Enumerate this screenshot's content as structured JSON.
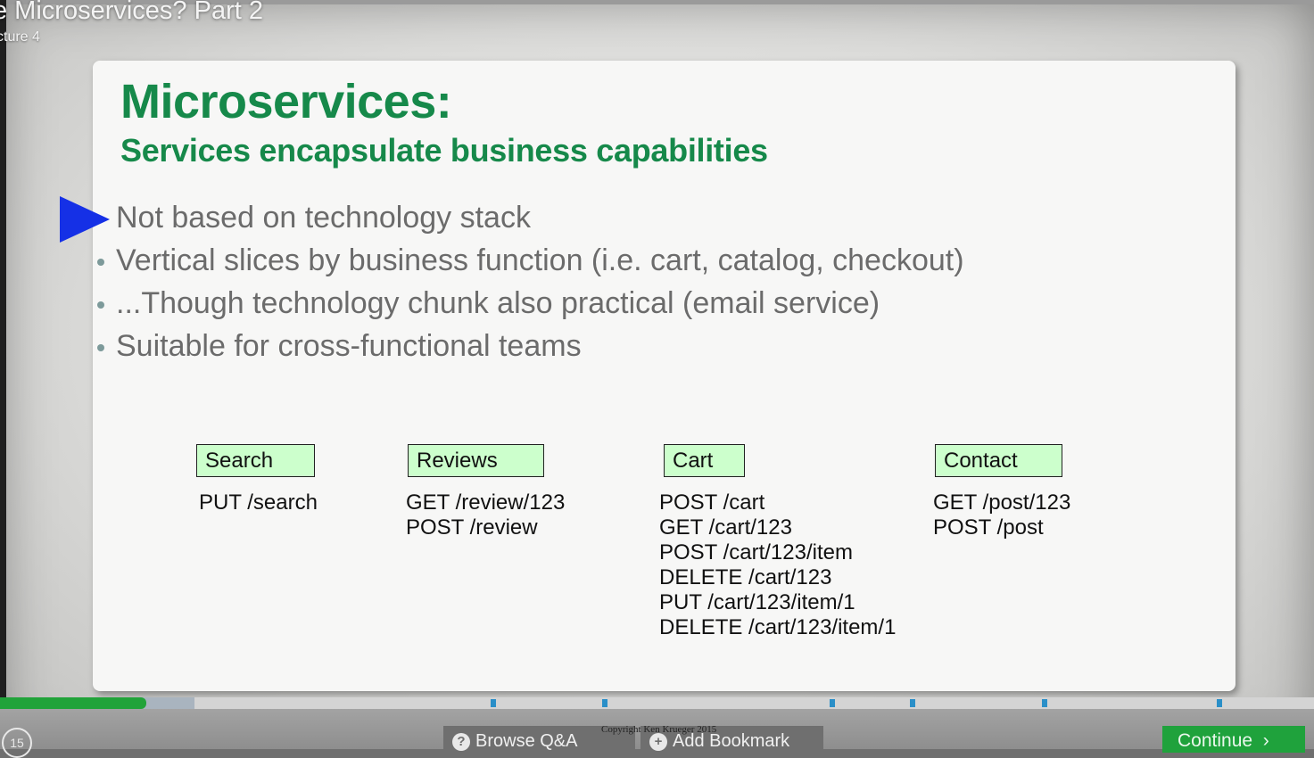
{
  "player": {
    "video_title": "e Microservices? Part 2",
    "video_subtitle": "cture 4"
  },
  "slide": {
    "title": "Microservices:",
    "subtitle": "Services encapsulate business capabilities",
    "bullets": [
      "Not based on technology stack",
      "Vertical slices by business function (i.e. cart, catalog, checkout)",
      "...Though technology chunk also practical (email service)",
      "Suitable for cross-functional teams"
    ],
    "services": [
      {
        "name": "Search",
        "endpoints": [
          "PUT /search"
        ]
      },
      {
        "name": "Reviews",
        "endpoints": [
          "GET /review/123",
          "POST /review"
        ]
      },
      {
        "name": "Cart",
        "endpoints": [
          "POST /cart",
          "GET /cart/123",
          "POST /cart/123/item",
          "DELETE /cart/123",
          "PUT /cart/123/item/1",
          "DELETE /cart/123/item/1"
        ]
      },
      {
        "name": "Contact",
        "endpoints": [
          "GET /post/123",
          "POST /post"
        ]
      }
    ],
    "copyright": "Copyright Ken Krueger 2015",
    "box_color": "#ccffcc",
    "heading_color": "#16894a",
    "pointer_color": "#1530e6"
  },
  "controls": {
    "replay_label": "15",
    "browse_qa_label": "Browse Q&A",
    "add_bookmark_label": "Add Bookmark",
    "continue_label": "Continue",
    "progress_fraction": 0.111,
    "buffered_fraction": 0.148,
    "accent_color": "#21a33a"
  }
}
